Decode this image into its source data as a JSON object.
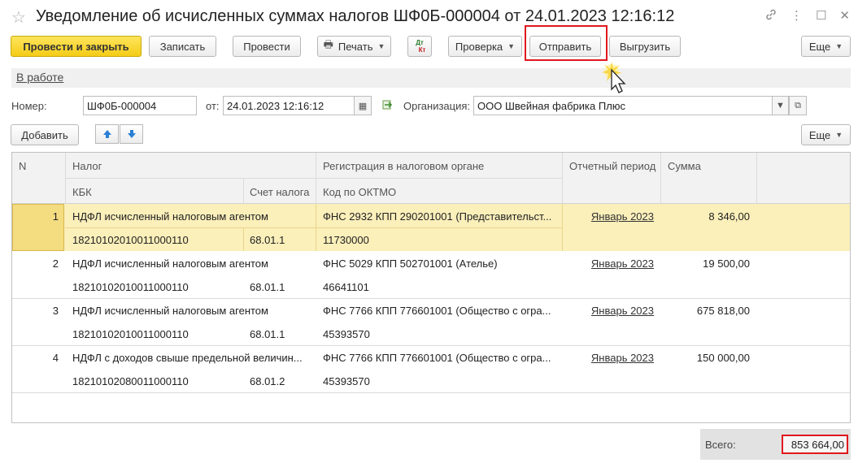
{
  "window": {
    "title": "Уведомление об исчисленных суммах налогов ШФ0Б-000004 от 24.01.2023 12:16:12"
  },
  "toolbar": {
    "post_close": "Провести и закрыть",
    "save": "Записать",
    "post": "Провести",
    "print": "Печать",
    "dtkt_top": "Дт",
    "dtkt_bottom": "Кт",
    "check": "Проверка",
    "send": "Отправить",
    "export": "Выгрузить",
    "more": "Еще"
  },
  "status": {
    "link": "В работе"
  },
  "form": {
    "number_label": "Номер:",
    "number_value": "ШФ0Б-000004",
    "date_label": "от:",
    "date_value": "24.01.2023 12:16:12",
    "org_label": "Организация:",
    "org_value": "ООО Швейная фабрика Плюс"
  },
  "table_toolbar": {
    "add": "Добавить",
    "more": "Еще"
  },
  "table": {
    "headers": {
      "n": "N",
      "tax": "Налог",
      "kbk": "КБК",
      "account": "Счет налога",
      "registration": "Регистрация в налоговом органе",
      "oktmo": "Код по ОКТМО",
      "period": "Отчетный период",
      "sum": "Сумма"
    },
    "rows": [
      {
        "n": "1",
        "tax": "НДФЛ исчисленный налоговым агентом",
        "kbk": "18210102010011000110",
        "account": "68.01.1",
        "registration": "ФНС 2932 КПП 290201001 (Представительст...",
        "oktmo": "11730000",
        "period": "Январь 2023",
        "sum": "8 346,00"
      },
      {
        "n": "2",
        "tax": "НДФЛ исчисленный налоговым агентом",
        "kbk": "18210102010011000110",
        "account": "68.01.1",
        "registration": "ФНС 5029 КПП 502701001 (Ателье)",
        "oktmo": "46641101",
        "period": "Январь 2023",
        "sum": "19 500,00"
      },
      {
        "n": "3",
        "tax": "НДФЛ исчисленный налоговым агентом",
        "kbk": "18210102010011000110",
        "account": "68.01.1",
        "registration": "ФНС 7766 КПП 776601001 (Общество с огра...",
        "oktmo": "45393570",
        "period": "Январь 2023",
        "sum": "675 818,00"
      },
      {
        "n": "4",
        "tax": "НДФЛ с доходов свыше предельной величин...",
        "kbk": "18210102080011000110",
        "account": "68.01.2",
        "registration": "ФНС 7766 КПП 776601001 (Общество с огра...",
        "oktmo": "45393570",
        "period": "Январь 2023",
        "sum": "150 000,00"
      }
    ]
  },
  "footer": {
    "total_label": "Всего:",
    "total_value": "853 664,00"
  },
  "colors": {
    "primary_button": "#f4cd17",
    "selected_row": "#fbefba",
    "highlight_frame": "#e0181e",
    "arrow_blue": "#2a7fd4"
  }
}
